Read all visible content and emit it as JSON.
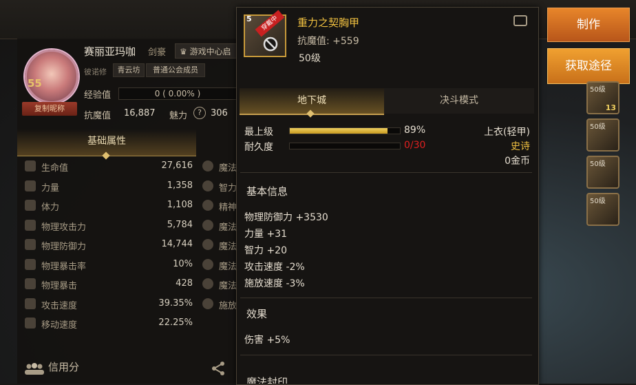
{
  "character": {
    "level_badge": "55",
    "copy_nickname_label": "复制昵称",
    "name": "赛丽亚玛咖",
    "class": "剑豪",
    "game_center_label": "游戏中心启",
    "sub_text_1": "彼诺修",
    "server": "青云坊",
    "guild_rank": "普通公会成员",
    "exp_label": "经验值",
    "exp_value": "0 ( 0.00% )",
    "anti_magic_label": "抗魔值",
    "anti_magic_value": "16,887",
    "charm_label": "魅力",
    "charm_value": "306"
  },
  "basic_tab_label": "基础属性",
  "stats_left": [
    {
      "label": "生命值",
      "value": "27,616"
    },
    {
      "label": "力量",
      "value": "1,358"
    },
    {
      "label": "体力",
      "value": "1,108"
    },
    {
      "label": "物理攻击力",
      "value": "5,784"
    },
    {
      "label": "物理防御力",
      "value": "14,744"
    },
    {
      "label": "物理暴击率",
      "value": "10%"
    },
    {
      "label": "物理暴击",
      "value": "428"
    },
    {
      "label": "攻击速度",
      "value": "39.35%"
    },
    {
      "label": "移动速度",
      "value": "22.25%"
    }
  ],
  "stats_right": [
    {
      "label": "魔法"
    },
    {
      "label": "智力"
    },
    {
      "label": "精神"
    },
    {
      "label": "魔法"
    },
    {
      "label": "魔法"
    },
    {
      "label": "魔法"
    },
    {
      "label": "魔法"
    },
    {
      "label": "施放"
    }
  ],
  "credit_label": "信用分",
  "tooltip": {
    "item_badge": "穿戴中",
    "item_level_tag": "5",
    "item_name": "重力之契胸甲",
    "anti_magic": "抗魔值: +559",
    "level": "50级",
    "tab_dungeon": "地下城",
    "tab_duel": "决斗模式",
    "upgrade_label": "最上级",
    "upgrade_value": "89%",
    "upgrade_fraction": 0.89,
    "durability_label": "耐久度",
    "durability_value": "0/30",
    "durability_fraction": 0.0,
    "slot_type": "上衣(轻甲)",
    "rarity": "史诗",
    "price": "0金币",
    "section_basic": "基本信息",
    "basic_attrs": [
      "物理防御力 +3530",
      "力量 +31",
      "智力 +20",
      "攻击速度 -2%",
      "施放速度 -3%"
    ],
    "section_effect": "效果",
    "effect_attrs": [
      "伤害 +5%"
    ],
    "section_next": "魔法封印"
  },
  "buttons": {
    "make": "制作",
    "get_route": "获取途径"
  },
  "slots": [
    {
      "label": "50级",
      "count": "13"
    },
    {
      "label": "50级",
      "count": ""
    },
    {
      "label": "50级",
      "count": ""
    },
    {
      "label": "50级",
      "count": ""
    }
  ],
  "colors": {
    "item_name": "#f0c040",
    "rarity": "#f0c040",
    "durability": "#e02020",
    "accent_orange": "#e8862a"
  }
}
